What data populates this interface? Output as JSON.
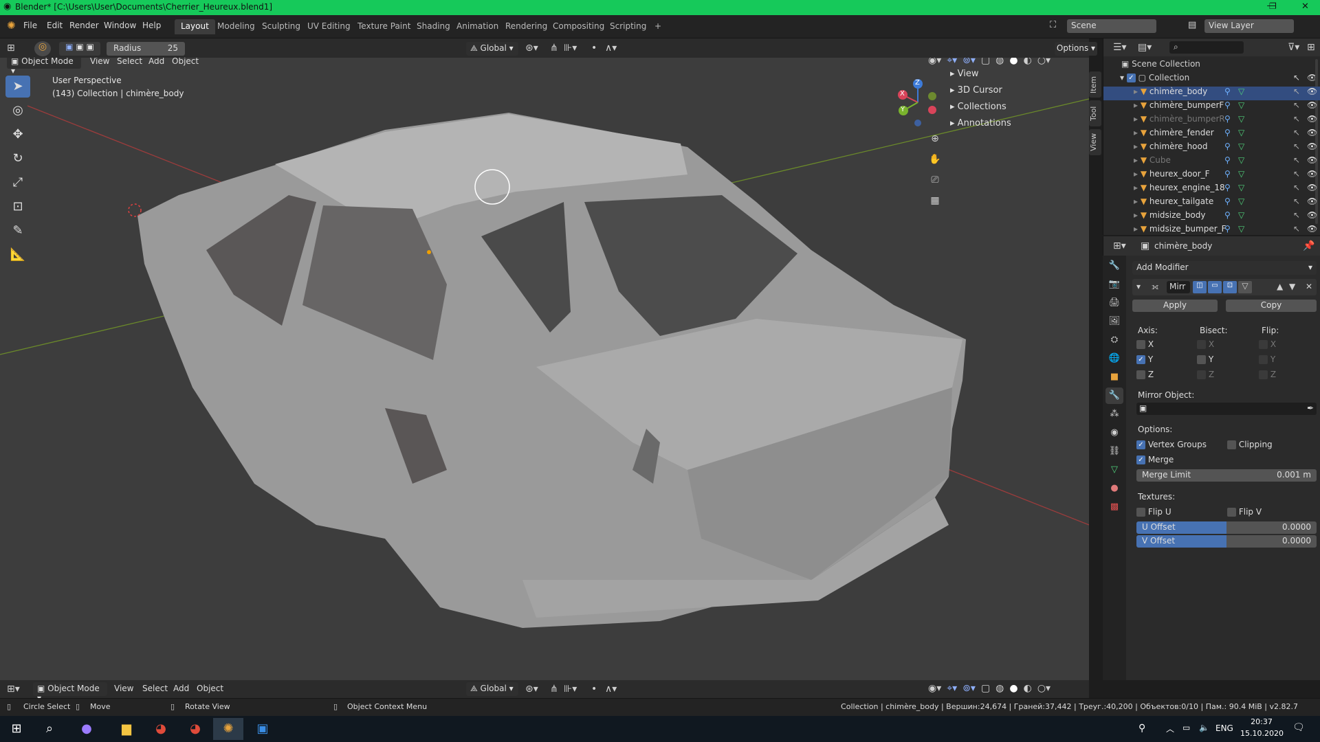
{
  "window": {
    "title": "Blender* [C:\\Users\\User\\Documents\\Cherrier_Heureux.blend1]",
    "minimize": "—",
    "restore": "❐",
    "close": "✕"
  },
  "menu": [
    "File",
    "Edit",
    "Render",
    "Window",
    "Help"
  ],
  "workspaces": [
    "Layout",
    "Modeling",
    "Sculpting",
    "UV Editing",
    "Texture Paint",
    "Shading",
    "Animation",
    "Rendering",
    "Compositing",
    "Scripting",
    "+"
  ],
  "active_workspace": "Layout",
  "scene": {
    "label": "Scene",
    "view_layer": "View Layer"
  },
  "tool_header": {
    "radius_label": "Radius",
    "radius_value": "25",
    "orientation": "Global",
    "options": "Options"
  },
  "viewport_header": {
    "mode": "Object Mode",
    "menus": [
      "View",
      "Select",
      "Add",
      "Object"
    ]
  },
  "viewport": {
    "perspective": "User Perspective",
    "info": "(143) Collection | chimère_body",
    "gizmo_z": "Z",
    "gizmo_x": "X",
    "gizmo_y": "Y"
  },
  "side_panel": {
    "items": [
      "View",
      "3D Cursor",
      "Collections",
      "Annotations"
    ]
  },
  "side_tabs": [
    "Item",
    "Tool",
    "View"
  ],
  "outliner": {
    "root": "Scene Collection",
    "collection": "Collection",
    "items": [
      {
        "name": "chimère_body",
        "dim": false
      },
      {
        "name": "chimère_bumperF",
        "dim": false
      },
      {
        "name": "chimère_bumperR",
        "dim": true
      },
      {
        "name": "chimère_fender",
        "dim": false
      },
      {
        "name": "chimère_hood",
        "dim": false
      },
      {
        "name": "Cube",
        "dim": true
      },
      {
        "name": "heurex_door_F",
        "dim": false
      },
      {
        "name": "heurex_engine_18",
        "dim": false
      },
      {
        "name": "heurex_tailgate",
        "dim": false
      },
      {
        "name": "midsize_body",
        "dim": false
      },
      {
        "name": "midsize_bumper_F",
        "dim": false
      }
    ]
  },
  "properties": {
    "object": "chimère_body",
    "add_modifier": "Add Modifier",
    "modifier_name": "Mirr",
    "apply": "Apply",
    "copy": "Copy",
    "axis_label": "Axis:",
    "bisect_label": "Bisect:",
    "flip_label": "Flip:",
    "axes": [
      "X",
      "Y",
      "Z"
    ],
    "axis_checked": [
      false,
      true,
      false
    ],
    "mirror_object_label": "Mirror Object:",
    "options_label": "Options:",
    "vertex_groups": "Vertex Groups",
    "clipping": "Clipping",
    "merge": "Merge",
    "merge_limit_label": "Merge Limit",
    "merge_limit_value": "0.001 m",
    "textures_label": "Textures:",
    "flip_u": "Flip U",
    "flip_v": "Flip V",
    "u_offset_label": "U Offset",
    "u_offset_value": "0.0000",
    "v_offset_label": "V Offset",
    "v_offset_value": "0.0000"
  },
  "bottom_header": {
    "mode": "Object Mode",
    "menus": [
      "View",
      "Select",
      "Add",
      "Object"
    ],
    "orientation": "Global"
  },
  "status": {
    "circle_select": "Circle Select",
    "move": "Move",
    "rotate": "Rotate View",
    "context": "Object Context Menu",
    "stats": "Collection | chimère_body | Вершин:24,674 | Граней:37,442 | Треуг.:40,200 | Объектов:0/10 | Пам.: 90.4 MiB | v2.82.7"
  },
  "taskbar": {
    "lang": "ENG",
    "time": "20:37",
    "date": "15.10.2020"
  },
  "colors": {
    "accent": "#4772b3",
    "title_green": "#16c95a",
    "viewport": "#3d3d3d",
    "mesh": "#a8a8a8"
  }
}
